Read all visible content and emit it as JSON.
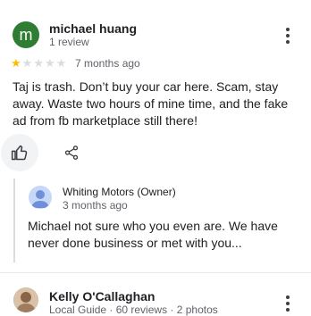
{
  "review": {
    "avatar_letter": "m",
    "reviewer_name": "michael huang",
    "reviewer_meta": "1 review",
    "rating": 1,
    "rating_max": 5,
    "date": "7 months ago",
    "text": "Taj is trash. Don’t buy your car here. Scam, stay away. Waste two hours of mine time, and the fake ad from fb marketplace still there!",
    "like_icon": "thumbs-up-icon",
    "share_icon": "share-icon",
    "menu_icon": "more-vert-icon"
  },
  "owner_response": {
    "name": "Whiting Motors (Owner)",
    "date": "3 months ago",
    "text": "Michael not sure who you even are. We have never done business or met with you..."
  },
  "next_review": {
    "reviewer_name": "Kelly O'Callaghan",
    "reviewer_meta": "Local Guide · 60 reviews · 2 photos"
  },
  "colors": {
    "avatar_m": "#2e7d32",
    "star_filled": "#fbbc04",
    "star_empty": "#dadce0"
  }
}
